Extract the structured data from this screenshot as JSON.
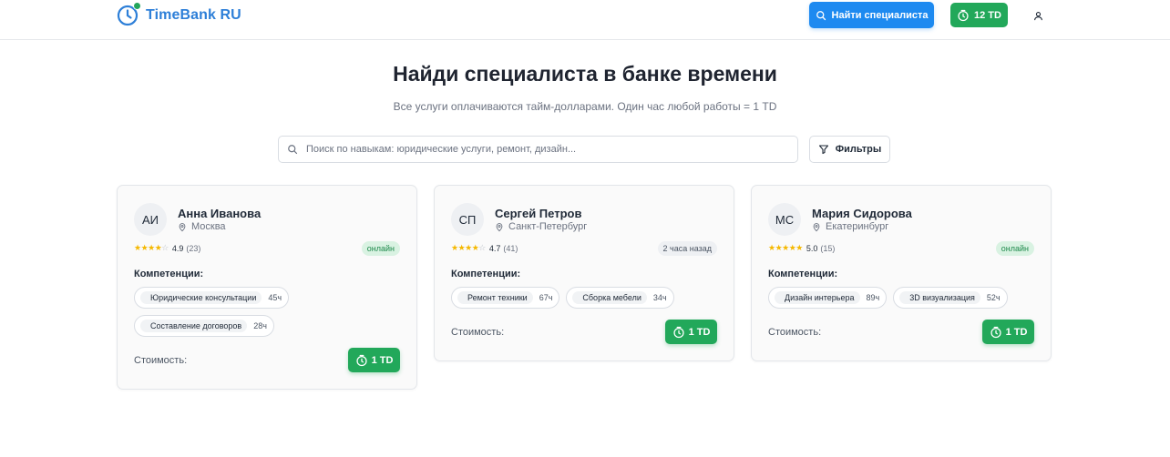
{
  "header": {
    "brand": "TimeBank RU",
    "find_button": "Найти специалиста",
    "balance": "12 TD",
    "accent": "#1d8af0",
    "success": "#22a85a"
  },
  "hero": {
    "title": "Найди специалиста в банке времени",
    "subtitle": "Все услуги оплачиваются тайм-долларами. Один час любой работы = 1 TD"
  },
  "search": {
    "placeholder": "Поиск по навыкам: юридические услуги, ремонт, дизайн...",
    "value": "",
    "filters_label": "Фильтры"
  },
  "cards": [
    {
      "initials": "АИ",
      "name": "Анна Иванова",
      "location": "Москва",
      "rating_stars": "★★★★",
      "rating_off": "☆",
      "rating": "4.9",
      "reviews": "(23)",
      "status": "онлайн",
      "competencies_label": "Компетенции:",
      "skills": [
        {
          "name": "Юридические консультации",
          "hours": "45ч"
        },
        {
          "name": "Составление договоров",
          "hours": "28ч"
        }
      ],
      "price_label": "Стоимость:",
      "price": "1 TD"
    },
    {
      "initials": "СП",
      "name": "Сергей Петров",
      "location": "Санкт-Петербург",
      "rating_stars": "★★★★",
      "rating_off": "☆",
      "rating": "4.7",
      "reviews": "(41)",
      "status": "2 часа назад",
      "competencies_label": "Компетенции:",
      "skills": [
        {
          "name": "Ремонт техники",
          "hours": "67ч"
        },
        {
          "name": "Сборка мебели",
          "hours": "34ч"
        }
      ],
      "price_label": "Стоимость:",
      "price": "1 TD"
    },
    {
      "initials": "МС",
      "name": "Мария Сидорова",
      "location": "Екатеринбург",
      "rating_stars": "★★★★★",
      "rating_off": "",
      "rating": "5.0",
      "reviews": "(15)",
      "status": "онлайн",
      "competencies_label": "Компетенции:",
      "skills": [
        {
          "name": "Дизайн интерьера",
          "hours": "89ч"
        },
        {
          "name": "3D визуализация",
          "hours": "52ч"
        }
      ],
      "price_label": "Стоимость:",
      "price": "1 TD"
    }
  ]
}
